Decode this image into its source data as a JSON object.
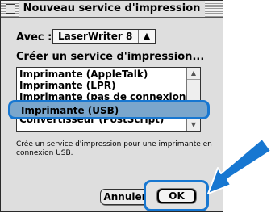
{
  "dialog": {
    "title": "Nouveau service d'impression",
    "avec_label": "Avec :",
    "select_value": "LaserWriter 8",
    "select_arrows": "⬧",
    "create_label": "Créer un service d'impression...",
    "list_items": [
      "Imprimante (AppleTalk)",
      "Imprimante (LPR)",
      "Imprimante (pas de connexion)",
      "Imprimante (USB)",
      "Convertisseur (PostScript)"
    ],
    "selected_item": "Imprimante (USB)",
    "description": "Crée un service d'impression pour une imprimante en connexion USB.",
    "cancel_label": "Annuler",
    "ok_label": "OK"
  },
  "colors": {
    "highlight_border": "#1777d1",
    "selection_fill": "#7aa6cc",
    "arrow": "#1777d1"
  }
}
